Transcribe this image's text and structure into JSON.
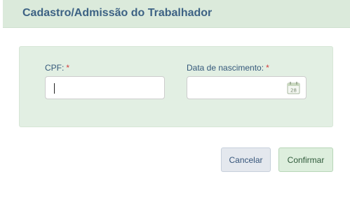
{
  "dialog": {
    "title": "Cadastro/Admissão do Trabalhador"
  },
  "form": {
    "cpf": {
      "label": "CPF:",
      "required_mark": "*",
      "value": ""
    },
    "birth_date": {
      "label": "Data de nascimento:",
      "required_mark": "*",
      "value": "",
      "calendar_day": "28"
    }
  },
  "buttons": {
    "cancel_label": "Cancelar",
    "confirm_label": "Confirmar"
  },
  "colors": {
    "header_bg": "#dbeadb",
    "panel_bg": "#e2efe3",
    "title_text": "#3d6284",
    "required": "#d23b3b"
  },
  "icons": {
    "date_picker": "calendar-icon"
  }
}
